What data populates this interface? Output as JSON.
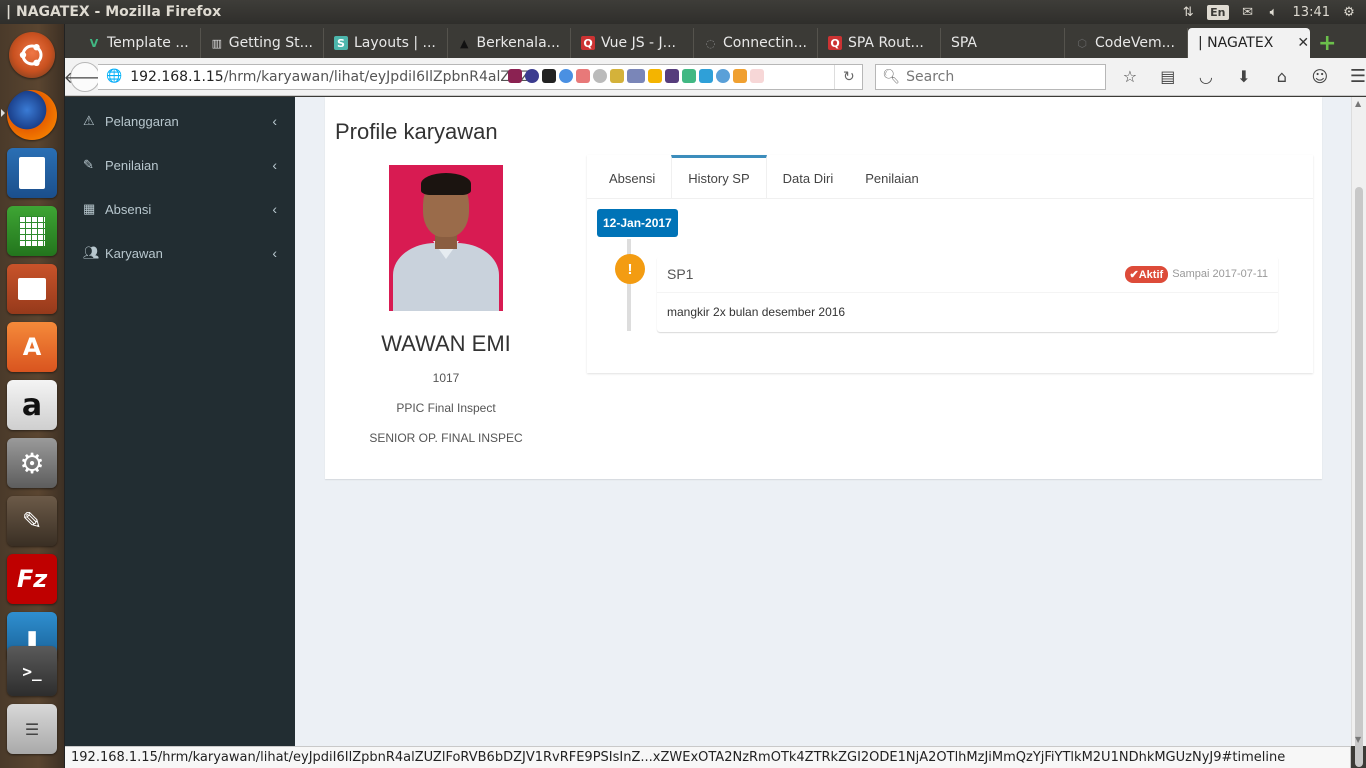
{
  "window": {
    "title": "| NAGATEX - Mozilla Firefox"
  },
  "system": {
    "language": "En",
    "time": "13:41"
  },
  "launcher": {
    "items": [
      "ubuntu-dash",
      "firefox",
      "writer",
      "calc",
      "impress",
      "software-center",
      "amazon",
      "system-settings",
      "gimp",
      "filezilla",
      "mysql-workbench",
      "terminal",
      "stacked-apps"
    ]
  },
  "tabs": [
    {
      "label": "Template ...",
      "icon": "vue-icon",
      "color": "#41b883"
    },
    {
      "label": "Getting St...",
      "icon": "book-icon",
      "color": "#e0e0e0"
    },
    {
      "label": "Layouts | ...",
      "icon": "s-icon",
      "color": "#4db6ac"
    },
    {
      "label": "Berkenala...",
      "icon": "hat-icon",
      "color": "#111111"
    },
    {
      "label": "Vue JS - J...",
      "icon": "q-icon",
      "color": "#cc3333"
    },
    {
      "label": "Connectin...",
      "icon": "spin-icon",
      "color": "#777777"
    },
    {
      "label": "SPA Rout...",
      "icon": "q-icon",
      "color": "#cc3333"
    },
    {
      "label": "SPA",
      "icon": "",
      "color": ""
    },
    {
      "label": "CodeVem...",
      "icon": "hex-icon",
      "color": "#666666"
    },
    {
      "label": "| NAGATEX",
      "icon": "",
      "color": "",
      "active": true
    }
  ],
  "url": {
    "host": "192.168.1.15",
    "path": "/hrm/karyawan/lihat/eyJpdiI6IlZpbnR4alZUZlI"
  },
  "search": {
    "placeholder": "Search"
  },
  "sidebar": {
    "items": [
      {
        "label": "Pelanggaran",
        "icon": "warning-icon"
      },
      {
        "label": "Penilaian",
        "icon": "edit-icon"
      },
      {
        "label": "Absensi",
        "icon": "calendar-icon"
      },
      {
        "label": "Karyawan",
        "icon": "users-icon"
      }
    ]
  },
  "profile": {
    "page_title": "Profile karyawan",
    "name": "WAWAN EMI",
    "id": "1017",
    "department": "PPIC Final Inspect",
    "position": "SENIOR OP. FINAL INSPEC"
  },
  "profile_tabs": [
    {
      "label": "Absensi"
    },
    {
      "label": "History SP",
      "active": true
    },
    {
      "label": "Data Diri"
    },
    {
      "label": "Penilaian"
    }
  ],
  "timeline": {
    "date": "12-Jan-2017",
    "item": {
      "title": "SP1",
      "status": "Aktif",
      "until": "Sampai 2017-07-11",
      "body": "mangkir 2x bulan desember 2016"
    }
  },
  "statusbar": {
    "text": "192.168.1.15/hrm/karyawan/lihat/eyJpdiI6IlZpbnR4alZUZlFoRVB6bDZJV1RvRFE9PSIsInZ...xZWExOTA2NzRmOTk4ZTRkZGI2ODE1NjA2OTlhMzJiMmQzYjFiYTlkM2U1NDhkMGUzNyJ9#timeline"
  },
  "colors": {
    "sidebar_bg": "#222d32",
    "primary": "#3c8dbc",
    "date_badge": "#0073b7",
    "warning": "#f39c12",
    "danger": "#dd4b39"
  }
}
